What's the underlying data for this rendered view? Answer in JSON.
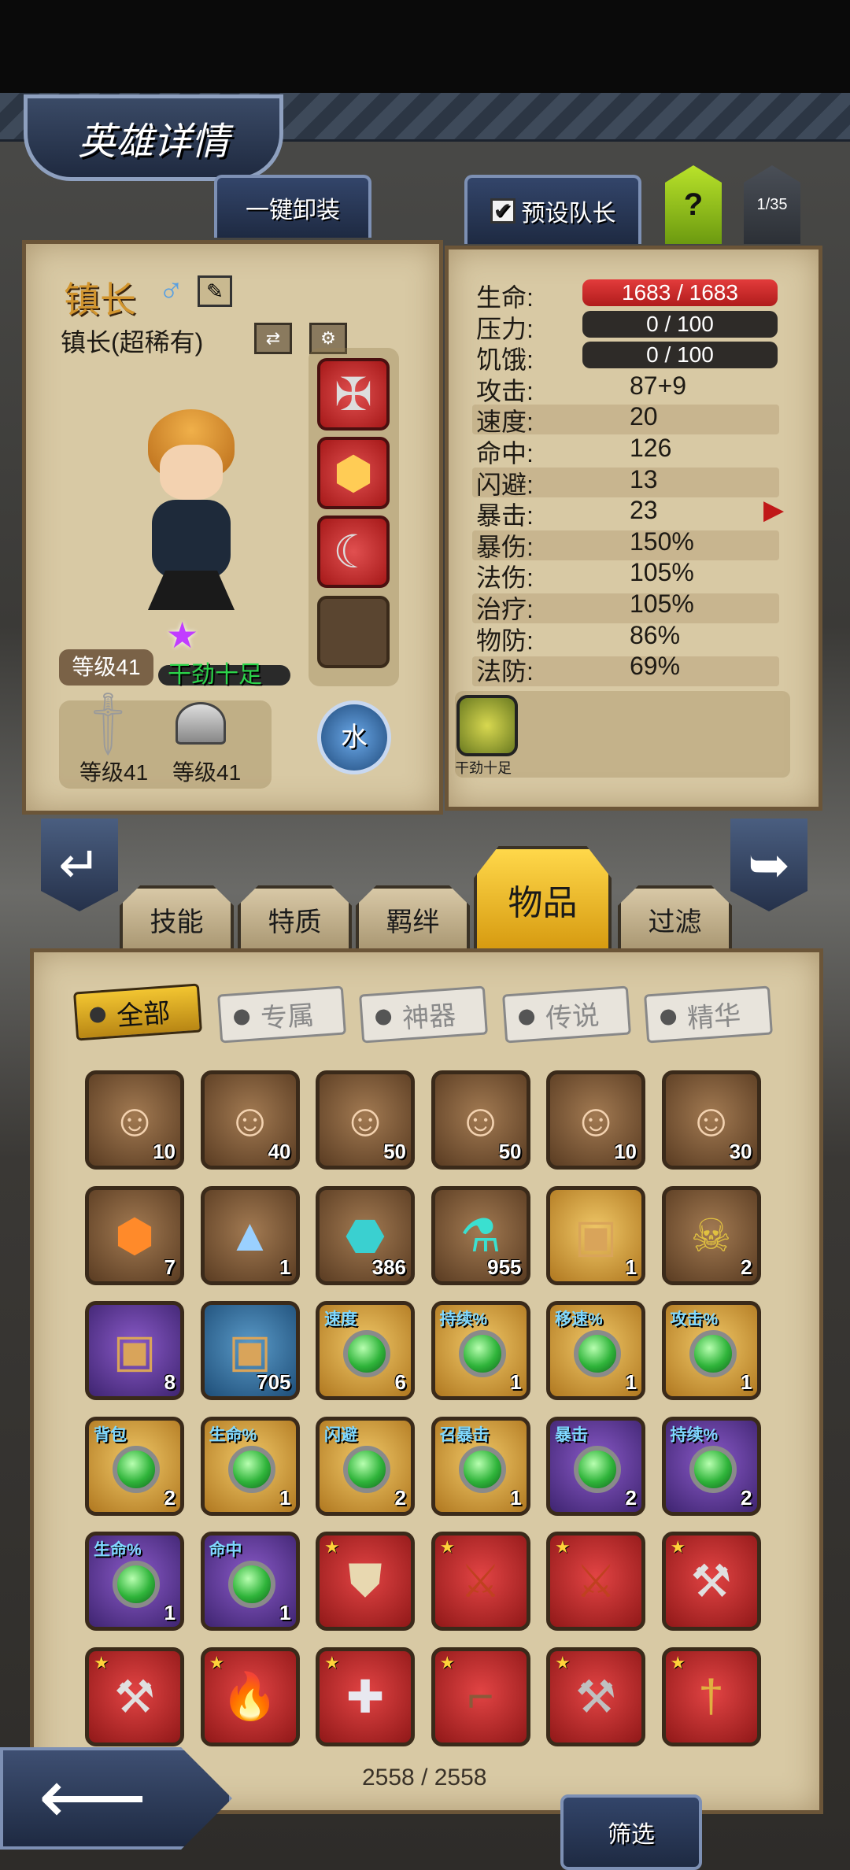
{
  "header": {
    "title": "英雄详情",
    "unequip_all": "一键卸装",
    "preset_leader": "预设队长",
    "help": "?",
    "page_count": "1/35"
  },
  "hero": {
    "name": "镇长",
    "gender_icon": "male-symbol",
    "subtitle": "镇长(超稀有)",
    "level": "等级41",
    "mood": "干劲十足",
    "weapon_level": "等级41",
    "armor_level": "等级41",
    "element": "水",
    "trait_label": "干劲十足"
  },
  "stats": [
    {
      "label": "生命:",
      "value": "1683 / 1683",
      "bar": "red"
    },
    {
      "label": "压力:",
      "value": "0 / 100",
      "bar": "dark"
    },
    {
      "label": "饥饿:",
      "value": "0 / 100",
      "bar": "dark"
    },
    {
      "label": "攻击:",
      "value": "87+9"
    },
    {
      "label": "速度:",
      "value": "20"
    },
    {
      "label": "命中:",
      "value": "126"
    },
    {
      "label": "闪避:",
      "value": "13"
    },
    {
      "label": "暴击:",
      "value": "23"
    },
    {
      "label": "暴伤:",
      "value": "150%"
    },
    {
      "label": "法伤:",
      "value": "105%"
    },
    {
      "label": "治疗:",
      "value": "105%"
    },
    {
      "label": "物防:",
      "value": "86%"
    },
    {
      "label": "法防:",
      "value": "69%"
    }
  ],
  "main_tabs": [
    "技能",
    "特质",
    "羁绊",
    "物品",
    "过滤"
  ],
  "active_main_tab": "物品",
  "sub_tabs": [
    "全部",
    "专属",
    "神器",
    "传说",
    "精华"
  ],
  "active_sub_tab": "全部",
  "items": [
    [
      {
        "bg": "brown",
        "art": "hero",
        "count": "10"
      },
      {
        "bg": "brown",
        "art": "hero",
        "count": "40"
      },
      {
        "bg": "brown",
        "art": "hero",
        "count": "50"
      },
      {
        "bg": "brown",
        "art": "hero",
        "count": "50"
      },
      {
        "bg": "brown",
        "art": "hero",
        "count": "10"
      },
      {
        "bg": "brown",
        "art": "hero",
        "count": "30"
      }
    ],
    [
      {
        "bg": "brown",
        "art": "orange-gem",
        "count": "7"
      },
      {
        "bg": "brown",
        "art": "crystal-pile",
        "count": "1"
      },
      {
        "bg": "brown",
        "art": "rune-stone",
        "count": "386"
      },
      {
        "bg": "brown",
        "art": "potion",
        "count": "955"
      },
      {
        "bg": "gold",
        "art": "chest",
        "count": "1"
      },
      {
        "bg": "brown",
        "art": "skull-bag",
        "count": "2"
      }
    ],
    [
      {
        "bg": "purple",
        "art": "chest",
        "count": "8"
      },
      {
        "bg": "blue",
        "art": "chest",
        "count": "705"
      },
      {
        "bg": "gold",
        "art": "green-gem",
        "tag": "速度",
        "count": "6"
      },
      {
        "bg": "gold",
        "art": "green-gem",
        "tag": "持续%",
        "count": "1"
      },
      {
        "bg": "gold",
        "art": "green-gem",
        "tag": "移速%",
        "count": "1"
      },
      {
        "bg": "gold",
        "art": "green-gem",
        "tag": "攻击%",
        "count": "1"
      }
    ],
    [
      {
        "bg": "gold",
        "art": "green-gem",
        "tag": "背包",
        "count": "2"
      },
      {
        "bg": "gold",
        "art": "green-gem",
        "tag": "生命%",
        "count": "1"
      },
      {
        "bg": "gold",
        "art": "green-gem",
        "tag": "闪避",
        "count": "2"
      },
      {
        "bg": "gold",
        "art": "green-gem",
        "tag": "召暴击",
        "count": "1"
      },
      {
        "bg": "purple",
        "art": "green-gem",
        "tag": "暴击",
        "count": "2"
      },
      {
        "bg": "purple",
        "art": "green-gem",
        "tag": "持续%",
        "count": "2"
      }
    ],
    [
      {
        "bg": "purple",
        "art": "green-gem",
        "tag": "生命%",
        "count": "1"
      },
      {
        "bg": "purple",
        "art": "green-gem",
        "tag": "命中",
        "count": "1"
      },
      {
        "bg": "red",
        "art": "shield",
        "star": "★"
      },
      {
        "bg": "red",
        "art": "crossed-blades",
        "star": "★"
      },
      {
        "bg": "red",
        "art": "crossed-blades",
        "star": "★"
      },
      {
        "bg": "red",
        "art": "axe",
        "star": "★"
      }
    ],
    [
      {
        "bg": "red",
        "art": "axe",
        "star": "★"
      },
      {
        "bg": "red",
        "art": "flame-sword",
        "star": "★"
      },
      {
        "bg": "red",
        "art": "medkit",
        "star": "★"
      },
      {
        "bg": "red",
        "art": "pistol",
        "star": "★"
      },
      {
        "bg": "red",
        "art": "battle-axe",
        "star": "★"
      },
      {
        "bg": "red",
        "art": "rapier",
        "star": "★"
      }
    ]
  ],
  "inventory_count": "2558 / 2558",
  "filter_button": "筛选",
  "colors": {
    "panel": "#d8c9a4",
    "accent_gold": "#f2c531",
    "nav_blue": "#2a3a5a",
    "hp_red": "#d02828"
  }
}
